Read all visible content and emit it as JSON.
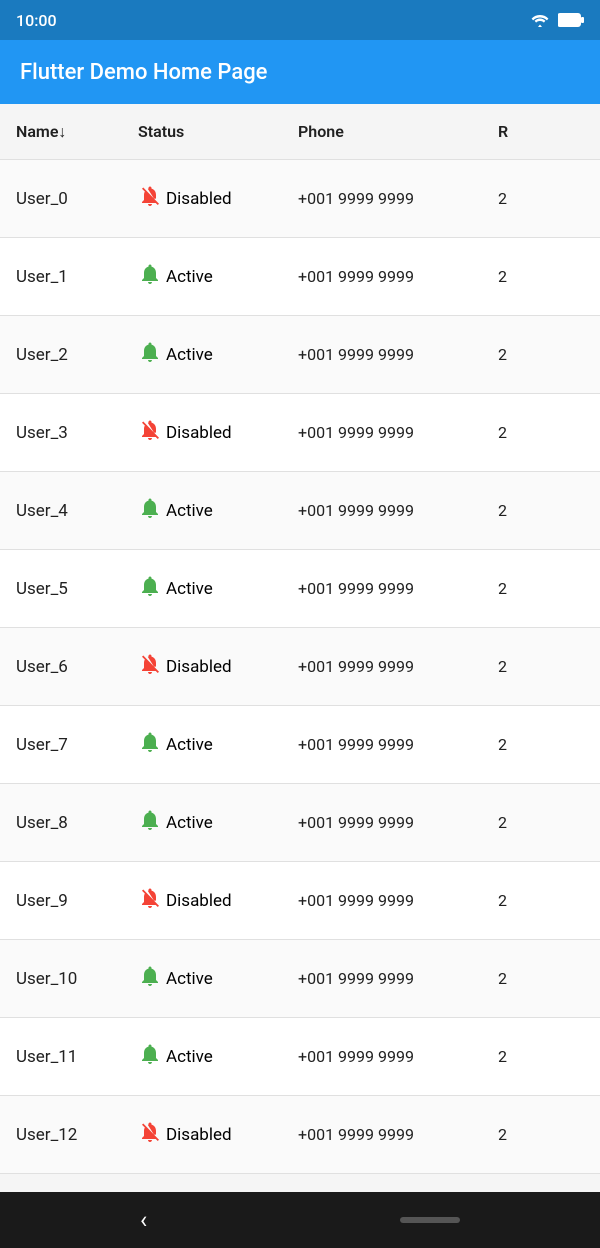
{
  "statusBar": {
    "time": "10:00"
  },
  "appBar": {
    "title": "Flutter Demo Home Page"
  },
  "tableHeader": {
    "col1": "Name↓",
    "col2": "Status",
    "col3": "Phone",
    "col4": "R"
  },
  "rows": [
    {
      "name": "User_0",
      "status": "Disabled",
      "phone": "+001 9999 9999",
      "extra": "2"
    },
    {
      "name": "User_1",
      "status": "Active",
      "phone": "+001 9999 9999",
      "extra": "2"
    },
    {
      "name": "User_2",
      "status": "Active",
      "phone": "+001 9999 9999",
      "extra": "2"
    },
    {
      "name": "User_3",
      "status": "Disabled",
      "phone": "+001 9999 9999",
      "extra": "2"
    },
    {
      "name": "User_4",
      "status": "Active",
      "phone": "+001 9999 9999",
      "extra": "2"
    },
    {
      "name": "User_5",
      "status": "Active",
      "phone": "+001 9999 9999",
      "extra": "2"
    },
    {
      "name": "User_6",
      "status": "Disabled",
      "phone": "+001 9999 9999",
      "extra": "2"
    },
    {
      "name": "User_7",
      "status": "Active",
      "phone": "+001 9999 9999",
      "extra": "2"
    },
    {
      "name": "User_8",
      "status": "Active",
      "phone": "+001 9999 9999",
      "extra": "2"
    },
    {
      "name": "User_9",
      "status": "Disabled",
      "phone": "+001 9999 9999",
      "extra": "2"
    },
    {
      "name": "User_10",
      "status": "Active",
      "phone": "+001 9999 9999",
      "extra": "2"
    },
    {
      "name": "User_11",
      "status": "Active",
      "phone": "+001 9999 9999",
      "extra": "2"
    },
    {
      "name": "User_12",
      "status": "Disabled",
      "phone": "+001 9999 9999",
      "extra": "2"
    }
  ],
  "bottomNav": {
    "backLabel": "‹"
  },
  "icons": {
    "bellActive": "🔔",
    "bellDisabled": "🔕"
  },
  "colors": {
    "active": "#4CAF50",
    "disabled": "#f44336",
    "appBar": "#2196F3",
    "statusBar": "#1a7abf"
  }
}
